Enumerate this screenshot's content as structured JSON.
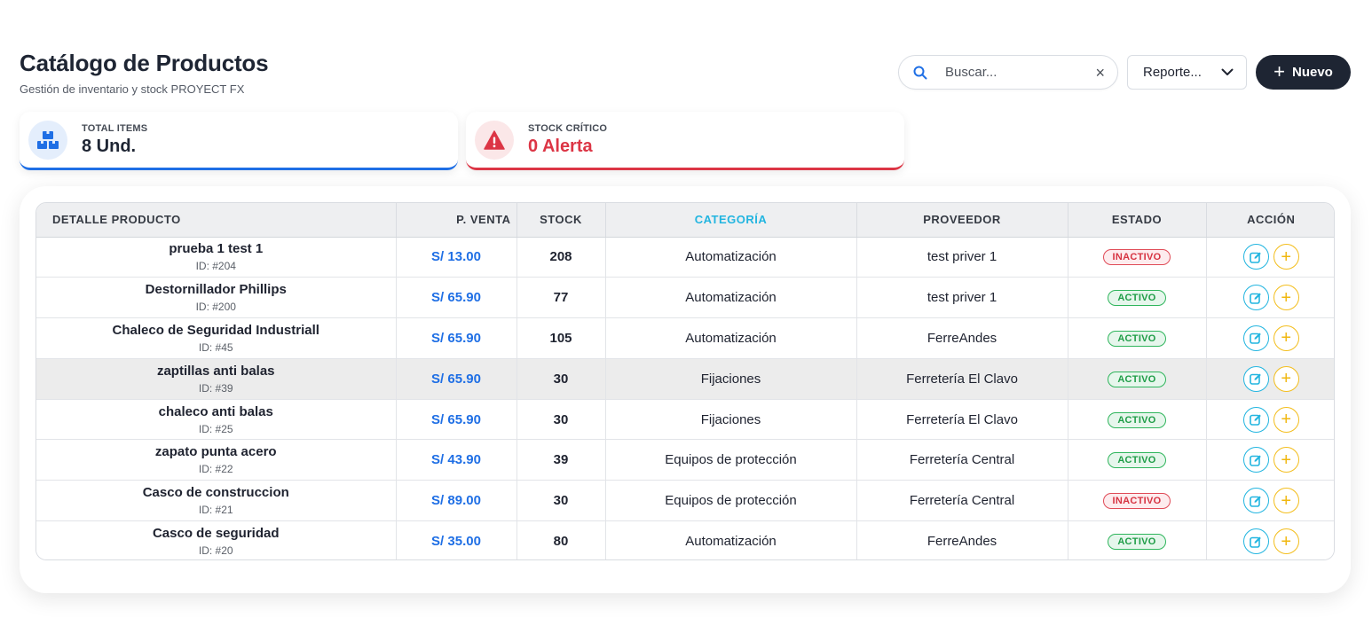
{
  "header": {
    "title": "Catálogo de Productos",
    "subtitle": "Gestión de inventario y stock PROYECT FX"
  },
  "toolbar": {
    "search_placeholder": "Buscar...",
    "search_icon": "search-icon",
    "clear_icon": "×",
    "report_label": "Reporte...",
    "new_label": "Nuevo"
  },
  "stats": {
    "total": {
      "label": "TOTAL ITEMS",
      "value": "8 Und.",
      "icon": "boxes-icon",
      "color": "#1f6fe5"
    },
    "critical": {
      "label": "STOCK CRÍTICO",
      "value": "0 Alerta",
      "icon": "warning-icon",
      "color": "#dc3545"
    }
  },
  "table": {
    "columns": [
      "DETALLE PRODUCTO",
      "P. VENTA",
      "STOCK",
      "CATEGORÍA",
      "PROVEEDOR",
      "ESTADO",
      "ACCIÓN"
    ],
    "rows": [
      {
        "name": "prueba 1 test 1",
        "id": "ID: #204",
        "price": "S/ 13.00",
        "stock": "208",
        "category": "Automatización",
        "provider": "test priver 1",
        "status": "INACTIVO"
      },
      {
        "name": "Destornillador Phillips",
        "id": "ID: #200",
        "price": "S/ 65.90",
        "stock": "77",
        "category": "Automatización",
        "provider": "test priver 1",
        "status": "ACTIVO"
      },
      {
        "name": "Chaleco de Seguridad Industriall",
        "id": "ID: #45",
        "price": "S/ 65.90",
        "stock": "105",
        "category": "Automatización",
        "provider": "FerreAndes",
        "status": "ACTIVO"
      },
      {
        "name": "zaptillas anti balas",
        "id": "ID: #39",
        "price": "S/ 65.90",
        "stock": "30",
        "category": "Fijaciones",
        "provider": "Ferretería El Clavo",
        "status": "ACTIVO"
      },
      {
        "name": "chaleco anti balas",
        "id": "ID: #25",
        "price": "S/ 65.90",
        "stock": "30",
        "category": "Fijaciones",
        "provider": "Ferretería El Clavo",
        "status": "ACTIVO"
      },
      {
        "name": "zapato punta acero",
        "id": "ID: #22",
        "price": "S/ 43.90",
        "stock": "39",
        "category": "Equipos de protección",
        "provider": "Ferretería Central",
        "status": "ACTIVO"
      },
      {
        "name": "Casco de construccion",
        "id": "ID: #21",
        "price": "S/ 89.00",
        "stock": "30",
        "category": "Equipos de protección",
        "provider": "Ferretería Central",
        "status": "INACTIVO"
      },
      {
        "name": "Casco de seguridad",
        "id": "ID: #20",
        "price": "S/ 35.00",
        "stock": "80",
        "category": "Automatización",
        "provider": "FerreAndes",
        "status": "ACTIVO"
      }
    ]
  },
  "colors": {
    "accent": "#1f6fe5",
    "dark": "#1e2533",
    "danger": "#dc3545",
    "success": "#1f9d47",
    "cyan": "#22b5e0",
    "yellow": "#f3be1d"
  }
}
